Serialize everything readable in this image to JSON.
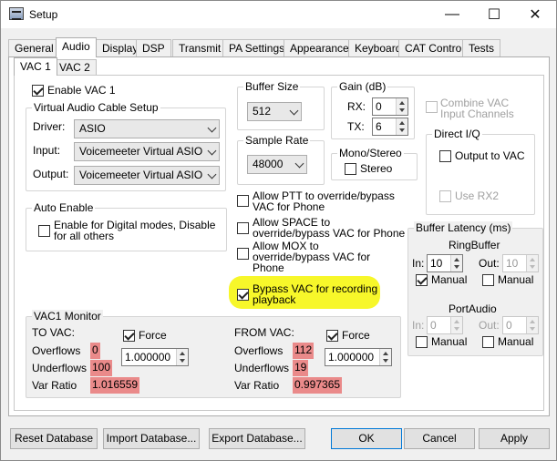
{
  "window": {
    "title": "Setup"
  },
  "titlebar": {
    "minimize": "—",
    "maximize": "☐",
    "close": "✕"
  },
  "tabs": [
    "General",
    "Audio",
    "Display",
    "DSP",
    "Transmit",
    "PA Settings",
    "Appearance",
    "Keyboard",
    "CAT Control",
    "Tests"
  ],
  "subtabs": [
    "VAC 1",
    "VAC 2"
  ],
  "enable_vac": {
    "label": "Enable VAC 1",
    "checked": true
  },
  "vac_setup": {
    "title": "Virtual Audio Cable Setup",
    "driver_label": "Driver:",
    "driver_value": "ASIO",
    "input_label": "Input:",
    "input_value": "Voicemeeter Virtual ASIO",
    "output_label": "Output:",
    "output_value": "Voicemeeter Virtual ASIO"
  },
  "auto_enable": {
    "title": "Auto Enable",
    "label_line1": "Enable for Digital modes, Disable",
    "label_line2": "for all others"
  },
  "buffer_size": {
    "title": "Buffer Size",
    "value": "512"
  },
  "sample_rate": {
    "title": "Sample Rate",
    "value": "48000"
  },
  "gain": {
    "title": "Gain (dB)",
    "rx_label": "RX:",
    "rx_value": "0",
    "tx_label": "TX:",
    "tx_value": "6"
  },
  "mono_stereo": {
    "title": "Mono/Stereo",
    "stereo_label": "Stereo"
  },
  "combine_vac": {
    "line1": "Combine VAC",
    "line2": "Input Channels"
  },
  "direct_iq": {
    "title": "Direct I/Q",
    "output_label": "Output to VAC",
    "rx2_label": "Use RX2"
  },
  "options": {
    "ptt_l1": "Allow PTT to override/bypass",
    "ptt_l2": "VAC for Phone",
    "space_l1": "Allow SPACE to",
    "space_l2": "override/bypass VAC for Phone",
    "mox_l1": "Allow MOX to",
    "mox_l2": "override/bypass VAC for",
    "mox_l3": "Phone",
    "bypass_l1": "Bypass VAC for recording",
    "bypass_l2": "playback"
  },
  "buffer_latency": {
    "title": "Buffer Latency (ms)",
    "ringbuffer_label": "RingBuffer",
    "rb_in_label": "In:",
    "rb_in_value": "10",
    "rb_out_label": "Out:",
    "rb_out_value": "10",
    "rb_manual_in": "Manual",
    "rb_manual_out": "Manual",
    "portaudio_label": "PortAudio",
    "pa_in_label": "In:",
    "pa_in_value": "0",
    "pa_out_label": "Out:",
    "pa_out_value": "0",
    "pa_manual_in": "Manual",
    "pa_manual_out": "Manual"
  },
  "monitor": {
    "title": "VAC1 Monitor",
    "to_label": "TO VAC:",
    "to_force": "Force",
    "to_overflows_label": "Overflows",
    "to_overflows": "0",
    "to_underflows_label": "Underflows",
    "to_underflows": "100",
    "to_ratio_label": "Var Ratio",
    "to_ratio": "1.016559",
    "to_spin": "1.000000",
    "from_label": "FROM VAC:",
    "from_force": "Force",
    "from_overflows_label": "Overflows",
    "from_overflows": "112",
    "from_underflows_label": "Underflows",
    "from_underflows": "19",
    "from_ratio_label": "Var Ratio",
    "from_ratio": "0.997365",
    "from_spin": "1.000000"
  },
  "footer": {
    "reset": "Reset Database",
    "import": "Import Database...",
    "export": "Export Database...",
    "ok": "OK",
    "cancel": "Cancel",
    "apply": "Apply"
  },
  "colors": {
    "highlight": "#f7f72a",
    "monitor_value_bg": "#ea8a8a"
  }
}
